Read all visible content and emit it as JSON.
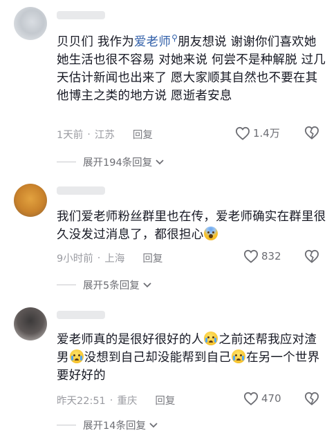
{
  "comments": [
    {
      "text_before": "贝贝们 我作为",
      "highlight": "爱老师",
      "text_after": "朋友想说 谢谢你们喜欢她 她生活也很不容易 对她来说 何尝不是种解脱 过几天估计新闻也出来了 愿大家顺其自然也不要在其他博主之类的地方说 愿逝者安息",
      "time": "1天前",
      "location": "江苏",
      "reply_label": "回复",
      "likes": "1.4万",
      "expand_label": "展开194条回复"
    },
    {
      "text": "我们爱老师粉丝群里也在传，爱老师确实在群里很久没发过消息了，都很担心",
      "time": "9小时前",
      "location": "上海",
      "reply_label": "回复",
      "likes": "832",
      "expand_label": "展开5条回复"
    },
    {
      "text_1": "爱老师真的是很好很好的人",
      "text_2": "之前还帮我应对渣男",
      "text_3": "没想到自己却没能帮到自己",
      "text_4": "在另一个世界要好好的",
      "time": "昨天22:51",
      "location": "重庆",
      "reply_label": "回复",
      "likes": "470",
      "expand_label": "展开14条回复"
    }
  ],
  "icons": {
    "search": "search-icon",
    "like": "heart-icon",
    "dislike": "broken-heart-icon",
    "expand": "chevron-down-icon"
  },
  "colors": {
    "highlight": "#2f5ea8",
    "meta": "#9a9ba1",
    "text": "#161823"
  }
}
